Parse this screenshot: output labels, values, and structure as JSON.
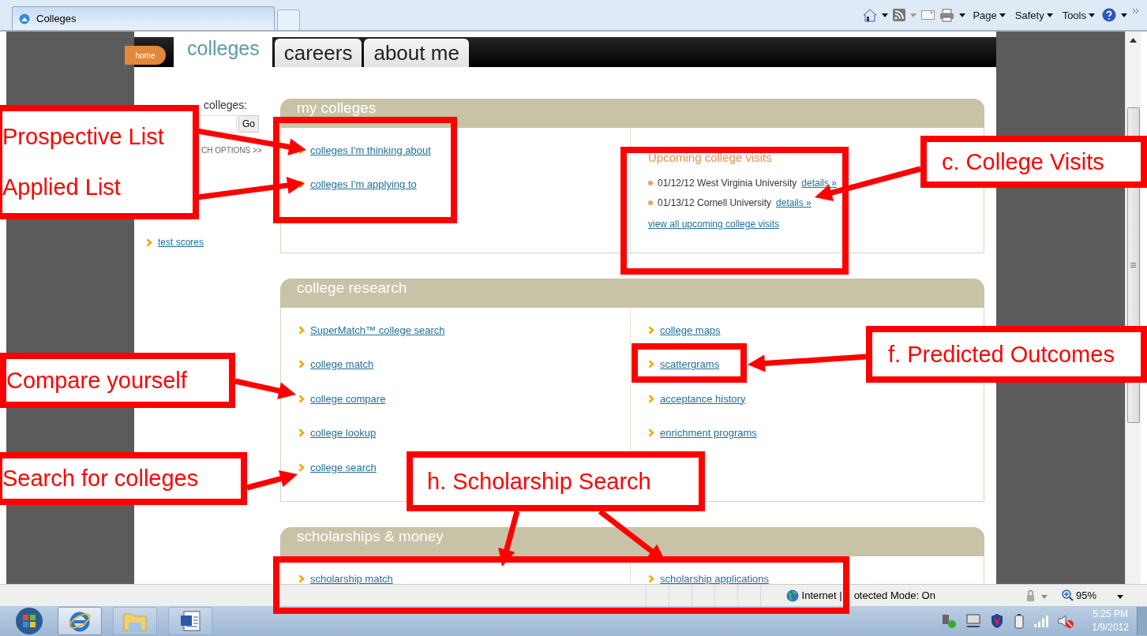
{
  "browser": {
    "tab_title": "Colleges",
    "menus": [
      "Page",
      "Safety",
      "Tools"
    ]
  },
  "site_nav": {
    "home": "home",
    "tabs": [
      {
        "label": "colleges",
        "selected": true
      },
      {
        "label": "careers",
        "selected": false
      },
      {
        "label": "about me",
        "selected": false
      }
    ]
  },
  "sidebar": {
    "search_label": "colleges:",
    "search_button": "Go",
    "options_link": "CH OPTIONS >>",
    "links": [
      "test scores"
    ]
  },
  "panels": [
    {
      "title": "my colleges",
      "columns": [
        [
          {
            "kind": "link",
            "text": "colleges I'm thinking about"
          },
          {
            "kind": "link",
            "text": "colleges I'm applying to"
          }
        ],
        [
          {
            "kind": "heading",
            "text": "Upcoming college visits"
          },
          {
            "kind": "visit",
            "text": "01/12/12 West Virginia University",
            "link": "details »"
          },
          {
            "kind": "visit",
            "text": "01/13/12 Cornell University",
            "link": "details »"
          },
          {
            "kind": "more",
            "text": "view all upcoming college visits"
          }
        ]
      ]
    },
    {
      "title": "college research",
      "columns": [
        [
          {
            "kind": "link",
            "text": "SuperMatch™ college search"
          },
          {
            "kind": "link",
            "text": "college match"
          },
          {
            "kind": "link",
            "text": "college compare"
          },
          {
            "kind": "link",
            "text": "college lookup"
          },
          {
            "kind": "link",
            "text": "college search"
          }
        ],
        [
          {
            "kind": "link",
            "text": "college maps"
          },
          {
            "kind": "link",
            "text": "scattergrams"
          },
          {
            "kind": "link",
            "text": "acceptance history"
          },
          {
            "kind": "link",
            "text": "enrichment programs"
          }
        ]
      ]
    },
    {
      "title": "scholarships & money",
      "columns": [
        [
          {
            "kind": "link",
            "text": "scholarship match"
          }
        ],
        [
          {
            "kind": "link",
            "text": "scholarship applications"
          }
        ]
      ]
    }
  ],
  "annotations": [
    {
      "lines": [
        "Prospective List",
        "Applied List"
      ]
    },
    {
      "lines": [
        "c. College Visits"
      ]
    },
    {
      "lines": [
        "f. Predicted Outcomes"
      ]
    },
    {
      "lines": [
        "Compare yourself"
      ]
    },
    {
      "lines": [
        "Search for colleges"
      ]
    },
    {
      "lines": [
        "h. Scholarship Search"
      ]
    }
  ],
  "status_bar": {
    "zone": "Internet |",
    "zone_rest": "otected Mode: On",
    "zoom": "95%"
  },
  "taskbar": {
    "time": "5:25 PM",
    "date": "1/9/2012"
  }
}
